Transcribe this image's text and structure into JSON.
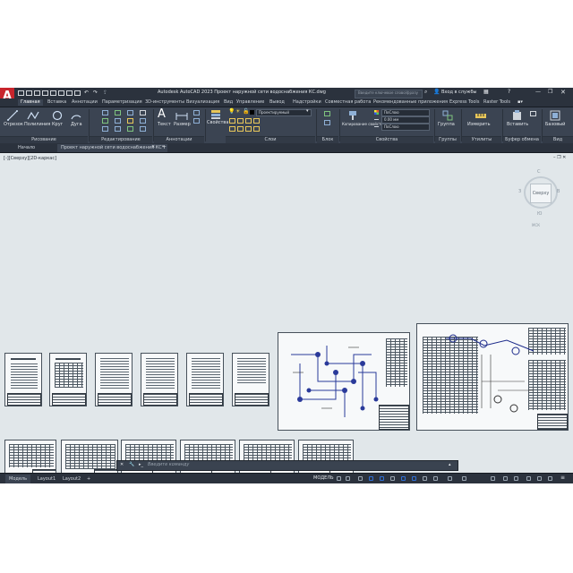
{
  "window": {
    "title": "Autodesk AutoCAD 2023  Проект наружной сети водоснабжения КС.dwg",
    "search_placeholder": "Введите ключевое слово/фразу",
    "signin_label": "Вход в службы"
  },
  "ribbon_tabs": [
    "Главная",
    "Вставка",
    "Аннотации",
    "Параметризация",
    "3D-инструменты",
    "Визуализация",
    "Вид",
    "Управление",
    "Вывод",
    "Надстройки",
    "Совместная работа",
    "Рекомендованные приложения",
    "Express Tools",
    "Raster Tools"
  ],
  "ribbon": {
    "draw_buttons": [
      "Отрезок",
      "Полилиния",
      "Круг",
      "Дуга"
    ],
    "annotation_buttons": [
      "Текст",
      "Размер"
    ],
    "block_button": "Свойства",
    "layer_current": "Проектируемый",
    "copy_props": "Копирование свойств",
    "color_field": "ПоСлою",
    "lineweight_field": "0.00 мм",
    "linetype_field": "ПоСлою",
    "group_button": "Группа",
    "measure_button": "Измерить",
    "paste_button": "Вставить",
    "base_button": "Базовый",
    "panels": [
      "Рисование",
      "Редактирование",
      "Аннотации",
      "Слои",
      "Блок",
      "Свойства",
      "Группы",
      "Утилиты",
      "Буфер обмена",
      "Вид"
    ]
  },
  "doc_tabs": {
    "start": "Начало",
    "file": "Проект наружной сети водоснабжения КС*",
    "add": "+"
  },
  "viewport": {
    "label": "[-][Сверху][2D-каркас]",
    "viewcube_face": "Сверху",
    "compass_n": "С",
    "compass_s": "Ю",
    "compass_e": "В",
    "compass_w": "З",
    "wcs": "МСК",
    "ucs_x": "X",
    "ucs_y": "Y"
  },
  "command": {
    "placeholder": "Введите команду"
  },
  "status": {
    "tabs": [
      "Модель",
      "Layout1",
      "Layout2"
    ],
    "add": "+",
    "mode": "МОДЕЛЬ"
  },
  "colors": {
    "canvas": "#e1e7ea",
    "ui_dark": "#222933",
    "ribbon": "#3b4452",
    "accent_blue": "#2f6fd6",
    "logo_red": "#c8252c"
  }
}
